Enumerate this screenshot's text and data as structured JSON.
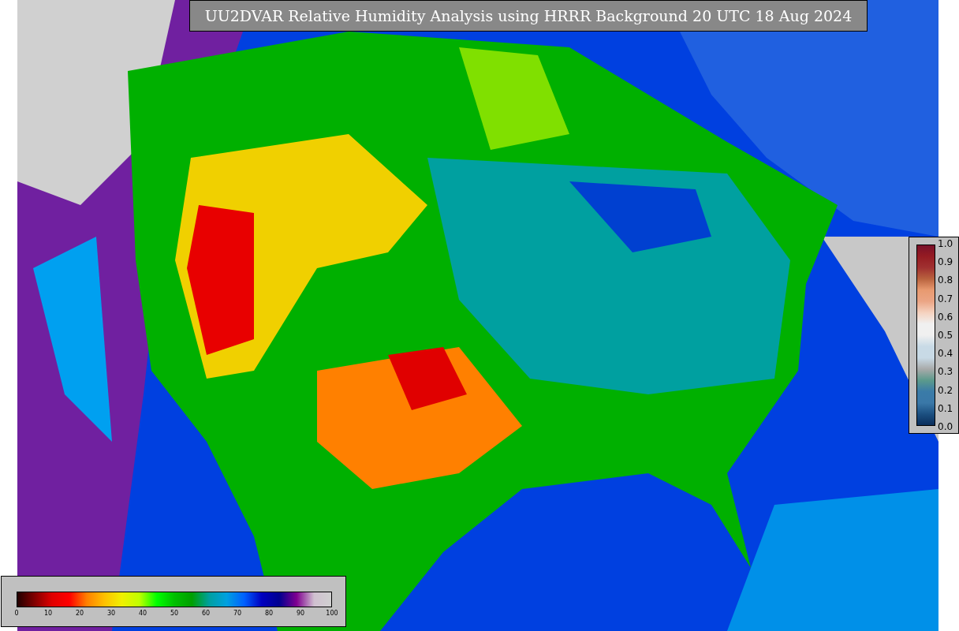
{
  "title": "UU2DVAR Relative Humidity Analysis using HRRR Background 20 UTC 18 Aug 2024",
  "humidity_legend": {
    "ticks": [
      "0",
      "10",
      "20",
      "30",
      "40",
      "50",
      "60",
      "70",
      "80",
      "90",
      "100"
    ]
  },
  "ratio_legend": {
    "ticks": [
      "1.0",
      "0.9",
      "0.8",
      "0.7",
      "0.6",
      "0.5",
      "0.4",
      "0.3",
      "0.2",
      "0.1",
      "0.0"
    ]
  }
}
